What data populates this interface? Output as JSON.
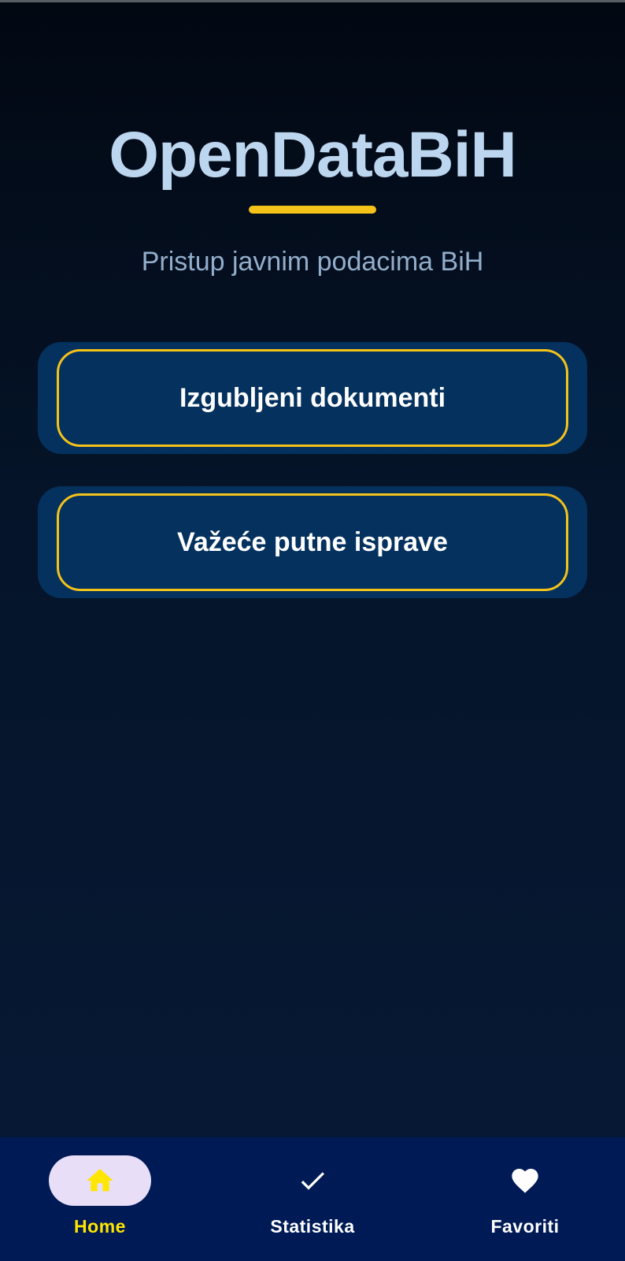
{
  "app": {
    "title": "OpenDataBiH",
    "subtitle": "Pristup javnim podacima BiH"
  },
  "menu": {
    "items": [
      {
        "label": "Izgubljeni dokumenti"
      },
      {
        "label": "Važeće putne isprave"
      }
    ]
  },
  "bottom_nav": {
    "items": [
      {
        "label": "Home",
        "icon": "home-icon",
        "selected": true
      },
      {
        "label": "Statistika",
        "icon": "check-icon",
        "selected": false
      },
      {
        "label": "Favoriti",
        "icon": "heart-icon",
        "selected": false
      }
    ]
  },
  "colors": {
    "background_top": "#020812",
    "background_bottom": "#061936",
    "accent_yellow": "#f5c21a",
    "card_blue": "#04315e",
    "nav_background": "#001a55",
    "nav_selected_label": "#ffe600",
    "nav_selected_pill": "#e8def8",
    "title_color": "#bcd6ef",
    "subtitle_color": "#92aecb"
  }
}
